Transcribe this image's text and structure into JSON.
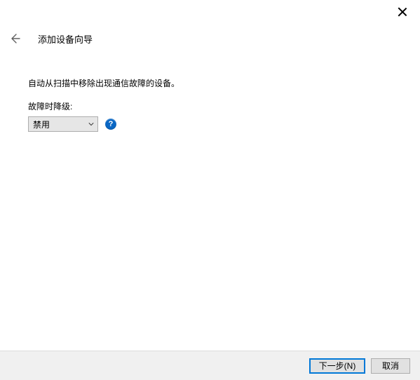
{
  "window": {
    "title": "添加设备向导"
  },
  "content": {
    "description": "自动从扫描中移除出现通信故障的设备。",
    "field_label": "故障时降级:",
    "demote_selected": "禁用"
  },
  "footer": {
    "next_label": "下一步(N)",
    "cancel_label": "取消"
  },
  "icons": {
    "help_glyph": "?"
  }
}
